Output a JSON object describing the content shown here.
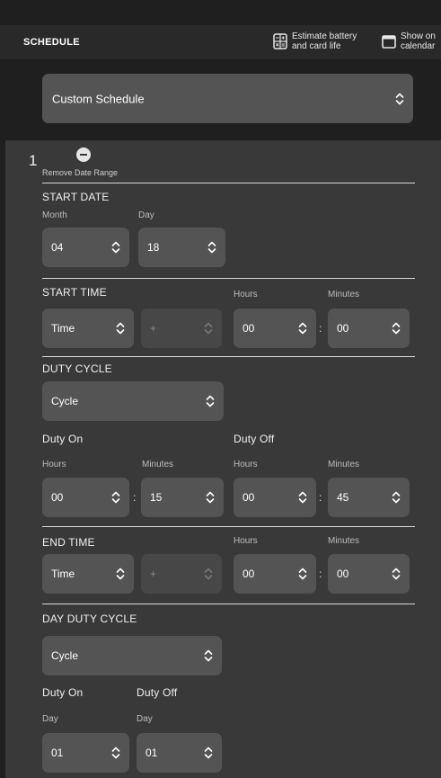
{
  "header": {
    "title": "SCHEDULE",
    "estimate_label_line1": "Estimate battery",
    "estimate_label_line2": "and card life",
    "calendar_label_line1": "Show on",
    "calendar_label_line2": "calendar",
    "estimate_icon": "calculator-icon",
    "calendar_icon": "calendar-icon"
  },
  "schedule_type": {
    "value": "Custom Schedule"
  },
  "range": {
    "index": "1",
    "remove_label": "Remove Date Range",
    "start_date": {
      "title": "START DATE",
      "month_label": "Month",
      "day_label": "Day",
      "month": "04",
      "day": "18"
    },
    "start_time": {
      "title": "START TIME",
      "hours_label": "Hours",
      "minutes_label": "Minutes",
      "mode": "Time",
      "offset": "+",
      "hours": "00",
      "colon": ":",
      "minutes": "00"
    },
    "duty_cycle": {
      "title": "DUTY CYCLE",
      "mode": "Cycle",
      "on_label": "Duty On",
      "off_label": "Duty Off",
      "hours_label": "Hours",
      "minutes_label": "Minutes",
      "on_hours": "00",
      "on_minutes": "15",
      "off_hours": "00",
      "off_minutes": "45",
      "colon": ":"
    },
    "end_time": {
      "title": "END TIME",
      "hours_label": "Hours",
      "minutes_label": "Minutes",
      "mode": "Time",
      "offset": "+",
      "hours": "00",
      "colon": ":",
      "minutes": "00"
    },
    "day_duty_cycle": {
      "title": "DAY DUTY CYCLE",
      "mode": "Cycle",
      "on_label": "Duty On",
      "off_label": "Duty Off",
      "day_label": "Day",
      "on_day": "01",
      "off_day": "01"
    }
  },
  "colors": {
    "background": "#1f1f1f",
    "header": "#292929",
    "panel": "#393939",
    "select": "#545454"
  }
}
